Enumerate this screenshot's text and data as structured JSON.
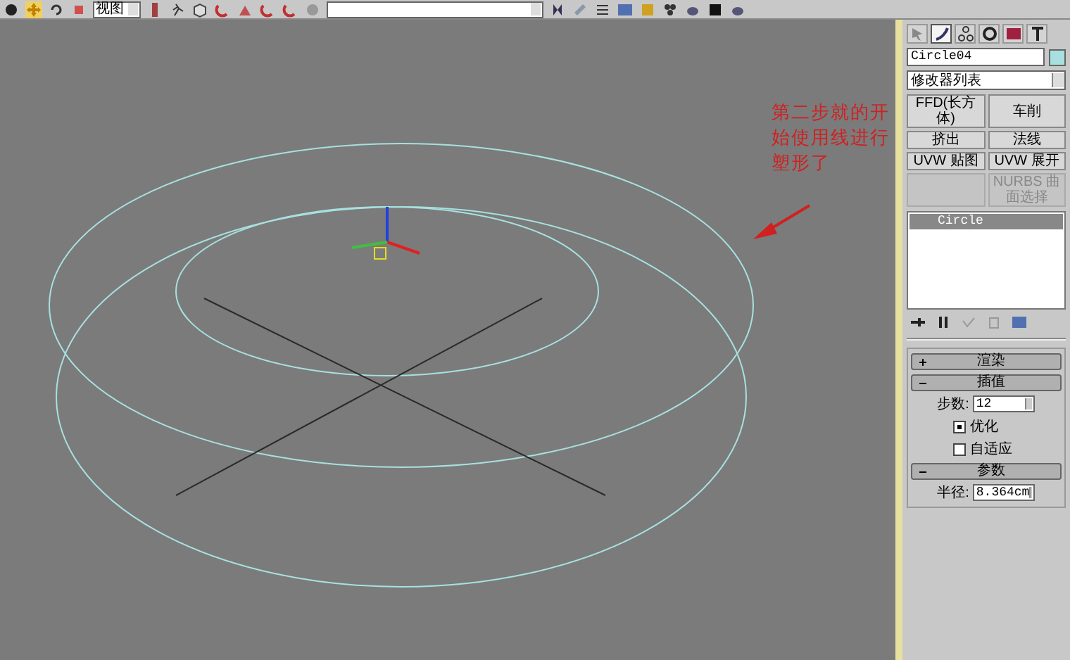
{
  "toolbar": {
    "view_dropdown": {
      "value": "视图"
    }
  },
  "viewport": {
    "annotation": "第二步就的开始使用线进行塑形了"
  },
  "command_panel": {
    "tabs": [
      {
        "selected": false
      },
      {
        "selected": true
      },
      {
        "selected": false
      },
      {
        "selected": false
      },
      {
        "selected": false
      },
      {
        "selected": false
      }
    ],
    "object_name": "Circle04",
    "modifier_list": {
      "value": "修改器列表"
    },
    "modifier_buttons": [
      {
        "label": "FFD(长方体)",
        "disabled": false
      },
      {
        "label": "车削",
        "disabled": false
      },
      {
        "label": "挤出",
        "disabled": false
      },
      {
        "label": "法线",
        "disabled": false
      },
      {
        "label": "UVW 贴图",
        "disabled": false
      },
      {
        "label": "UVW 展开",
        "disabled": false
      },
      {
        "disabled": true
      },
      {
        "label": "NURBS 曲面选择",
        "disabled": true
      }
    ],
    "stack": [
      {
        "label": "Circle",
        "selected": true
      }
    ],
    "rollouts": [
      {
        "title": "渲染",
        "expanded": false
      },
      {
        "title": "插值",
        "expanded": true,
        "fields": [
          {
            "kind": "spinner",
            "label": "步数:",
            "value": "12"
          },
          {
            "kind": "checkbox",
            "label": "优化",
            "checked": true
          },
          {
            "kind": "checkbox",
            "label": "自适应",
            "checked": false
          }
        ]
      },
      {
        "title": "参数",
        "expanded": true,
        "fields": [
          {
            "kind": "spinner",
            "label": "半径:",
            "value": "8.364cm"
          }
        ]
      }
    ]
  }
}
